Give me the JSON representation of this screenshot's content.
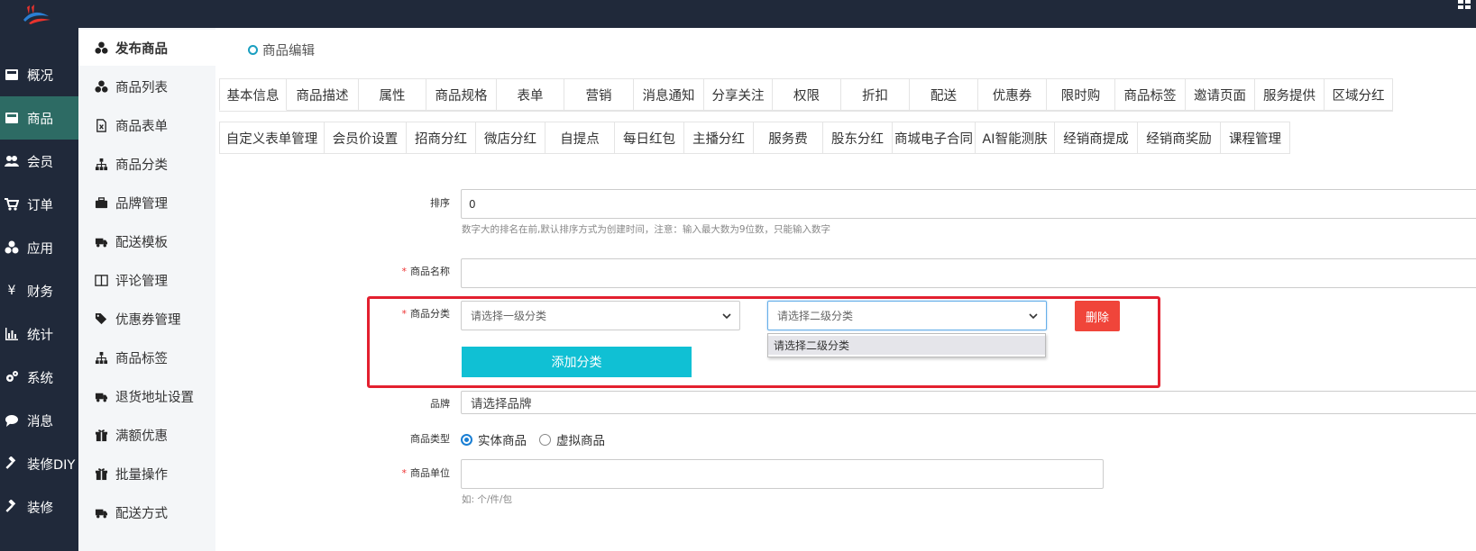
{
  "colors": {
    "topbar": "#20293a",
    "active_nav": "#2d6b64",
    "accent": "#10c0d4",
    "danger": "#f0453a",
    "highlight_box": "#e3202f"
  },
  "leftnav": [
    {
      "label": "概况",
      "icon": "dashboard-icon"
    },
    {
      "label": "商品",
      "icon": "product-icon",
      "active": true
    },
    {
      "label": "会员",
      "icon": "users-icon"
    },
    {
      "label": "订单",
      "icon": "cart-icon"
    },
    {
      "label": "应用",
      "icon": "apps-icon"
    },
    {
      "label": "财务",
      "icon": "yen-icon"
    },
    {
      "label": "统计",
      "icon": "chart-icon"
    },
    {
      "label": "系统",
      "icon": "gears-icon"
    },
    {
      "label": "消息",
      "icon": "message-icon"
    },
    {
      "label": "装修DIY",
      "icon": "gavel-icon"
    },
    {
      "label": "装修",
      "icon": "gavel-icon"
    }
  ],
  "subnav": [
    {
      "label": "发布商品",
      "icon": "cubes-icon",
      "active": true
    },
    {
      "label": "商品列表",
      "icon": "cubes-icon"
    },
    {
      "label": "商品表单",
      "icon": "form-file-icon"
    },
    {
      "label": "商品分类",
      "icon": "sitemap-icon"
    },
    {
      "label": "品牌管理",
      "icon": "briefcase-icon"
    },
    {
      "label": "配送模板",
      "icon": "truck-icon"
    },
    {
      "label": "评论管理",
      "icon": "book-icon"
    },
    {
      "label": "优惠券管理",
      "icon": "tags-icon"
    },
    {
      "label": "商品标签",
      "icon": "sitemap-icon"
    },
    {
      "label": "退货地址设置",
      "icon": "truck-icon"
    },
    {
      "label": "满额优惠",
      "icon": "gift-icon"
    },
    {
      "label": "批量操作",
      "icon": "gift-icon"
    },
    {
      "label": "配送方式",
      "icon": "truck-icon"
    }
  ],
  "breadcrumb": "商品编辑",
  "tabs_row1": [
    "基本信息",
    "商品描述",
    "属性",
    "商品规格",
    "表单",
    "营销",
    "消息通知",
    "分享关注",
    "权限",
    "折扣",
    "配送",
    "优惠券",
    "限时购",
    "商品标签",
    "邀请页面",
    "服务提供",
    "区域分红"
  ],
  "tabs_row2": [
    "自定义表单管理",
    "会员价设置",
    "招商分红",
    "微店分红",
    "自提点",
    "每日红包",
    "主播分红",
    "服务费",
    "股东分红",
    "商城电子合同",
    "AI智能测肤",
    "经销商提成",
    "经销商奖励",
    "课程管理"
  ],
  "form": {
    "sort_label": "排序",
    "sort_value": "0",
    "sort_hint": "数字大的排名在前,默认排序方式为创建时间，注意：输入最大数为9位数，只能输入数字",
    "required_mark": "*",
    "name_label": "商品名称",
    "name_value": "",
    "category_label": "商品分类",
    "category1_placeholder": "请选择一级分类",
    "category2_placeholder": "请选择二级分类",
    "category2_options": [
      "请选择二级分类"
    ],
    "delete_button": "删除",
    "add_category_button": "添加分类",
    "brand_label": "品牌",
    "brand_placeholder": "请选择品牌",
    "type_label": "商品类型",
    "type_options": [
      {
        "label": "实体商品",
        "checked": true
      },
      {
        "label": "虚拟商品",
        "checked": false
      }
    ],
    "unit_label": "商品单位",
    "unit_value": "",
    "unit_hint": "如: 个/件/包"
  }
}
